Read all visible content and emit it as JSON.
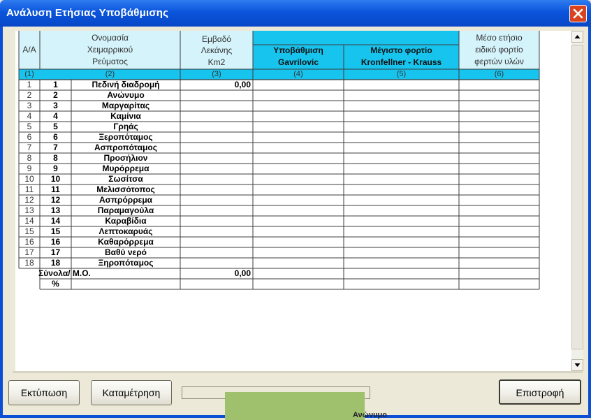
{
  "window": {
    "title": "Ανάλυση Ετήσιας Υποβάθμισης"
  },
  "header": {
    "aa": "Α/Α",
    "name_l1": "Ονομασία",
    "name_l2": "Χειμαρρικού",
    "name_l3": "Ρεύματος",
    "area_l1": "Εμβαδό",
    "area_l2": "Λεκάνης",
    "area_l3": "Km2",
    "gav_l1": "Υποβάθμιση",
    "gav_l2": "Gavrilovic",
    "kk_l1": "Μέγιστο φορτίο",
    "kk_l2": "Kronfellner - Krauss",
    "avg_l1": "Μέσο ετήσιο",
    "avg_l2": "ειδικό φορτίο",
    "avg_l3": "φερτών υλών",
    "index": [
      "(1)",
      "(2)",
      "(3)",
      "(4)",
      "(5)",
      "(6)"
    ]
  },
  "rows": [
    {
      "aa": "1",
      "code": "1",
      "name": "Πεδινή διαδρομή",
      "area": "0,00"
    },
    {
      "aa": "2",
      "code": "2",
      "name": "Ανώνυμο",
      "area": ""
    },
    {
      "aa": "3",
      "code": "3",
      "name": "Μαργαρίτας",
      "area": ""
    },
    {
      "aa": "4",
      "code": "4",
      "name": "Καμίνια",
      "area": ""
    },
    {
      "aa": "5",
      "code": "5",
      "name": "Γρηάς",
      "area": ""
    },
    {
      "aa": "6",
      "code": "6",
      "name": "Ξεροπόταμος",
      "area": ""
    },
    {
      "aa": "7",
      "code": "7",
      "name": "Ασπροπόταμος",
      "area": ""
    },
    {
      "aa": "8",
      "code": "8",
      "name": "Προσήλιον",
      "area": ""
    },
    {
      "aa": "9",
      "code": "9",
      "name": "Μυρόρρεμα",
      "area": ""
    },
    {
      "aa": "10",
      "code": "10",
      "name": "Σωσίτσα",
      "area": ""
    },
    {
      "aa": "11",
      "code": "11",
      "name": "Μελισσότοπος",
      "area": ""
    },
    {
      "aa": "12",
      "code": "12",
      "name": "Ασπρόρρεμα",
      "area": ""
    },
    {
      "aa": "13",
      "code": "13",
      "name": "Παραμαγούλα",
      "area": ""
    },
    {
      "aa": "14",
      "code": "14",
      "name": "Καραβίδια",
      "area": ""
    },
    {
      "aa": "15",
      "code": "15",
      "name": "Λεπτοκαρυάς",
      "area": ""
    },
    {
      "aa": "16",
      "code": "16",
      "name": "Καθαρόρρεμα",
      "area": ""
    },
    {
      "aa": "17",
      "code": "17",
      "name": "Βαθύ νερό",
      "area": ""
    },
    {
      "aa": "18",
      "code": "18",
      "name": "Ξηροπόταμος",
      "area": ""
    }
  ],
  "totals": {
    "label": "Σύνολα/ Μ.Ο.",
    "area": "0,00",
    "percent_label": "%"
  },
  "buttons": {
    "print": "Εκτύπωση",
    "count": "Καταμέτρηση",
    "back": "Επιστροφή"
  },
  "background_text": "Ανώνυμο",
  "colors": {
    "header_bg": "#d4f3fb",
    "header_dark_bg": "#17c4ee",
    "titlebar": "#0a55dc",
    "close": "#d9431f"
  }
}
